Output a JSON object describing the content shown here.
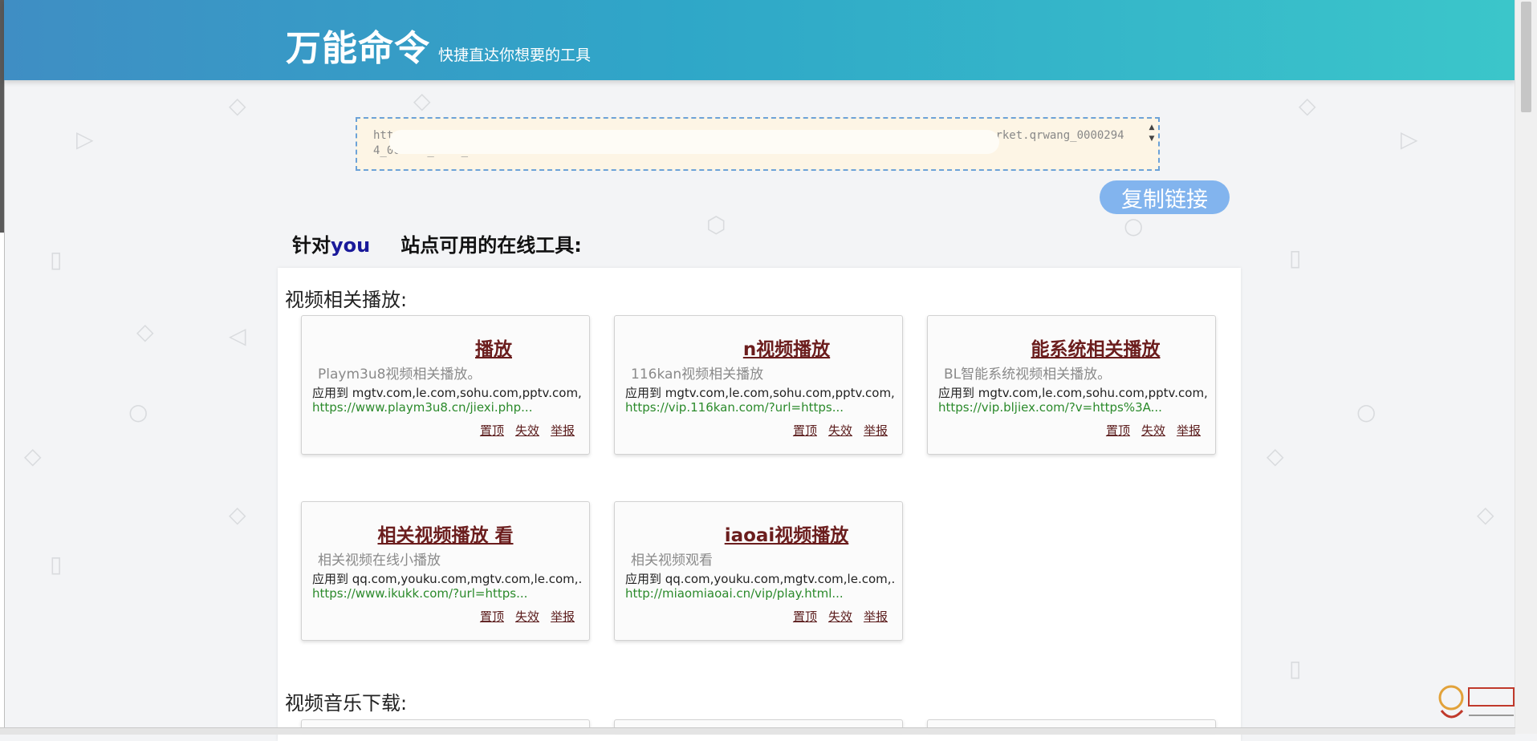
{
  "header": {
    "title": "万能命令",
    "subtitle": "快捷直达你想要的工具"
  },
  "url_box": {
    "text": "https://v.youku.com/v_show/id_XNTM0OTE5...tps=VWhqUNHR6WMwhYBwVmRKW0M&refer=sousuotoufang_market.qrwang_00002944_000000_...i_1903 1900"
  },
  "copy_button": {
    "label": "复制链接"
  },
  "site_heading": {
    "prefix": "针对",
    "site": "you",
    "suffix": "站点可用的在线工具:"
  },
  "actions": {
    "pin": "置顶",
    "invalid": "失效",
    "report": "举报"
  },
  "sections": [
    {
      "title": "视频相关播放:",
      "cards": [
        {
          "title": "播放",
          "desc": "Playm3u8视频相关播放。",
          "sites": "应用到 mgtv.com,le.com,sohu.com,pptv.com,...",
          "url": "https://www.playm3u8.cn/jiexi.php..."
        },
        {
          "title": "n视频播放",
          "desc": "116kan视频相关播放",
          "sites": "应用到 mgtv.com,le.com,sohu.com,pptv.com,...",
          "url": "https://vip.116kan.com/?url=https..."
        },
        {
          "title": "能系统相关播放",
          "desc": "BL智能系统视频相关播放。",
          "sites": "应用到 mgtv.com,le.com,sohu.com,pptv.com,...",
          "url": "https://vip.bljiex.com/?v=https%3A..."
        },
        {
          "title": "相关视频播放 看",
          "desc": "相关视频在线小播放",
          "sites": "应用到 qq.com,youku.com,mgtv.com,le.com,...",
          "url": "https://www.ikukk.com/?url=https..."
        },
        {
          "title": "iaoai视频播放",
          "desc": "相关视频观看",
          "sites": "应用到 qq.com,youku.com,mgtv.com,le.com,...",
          "url": "http://miaomiaoai.cn/vip/play.html..."
        }
      ]
    },
    {
      "title": "视频音乐下载:"
    }
  ],
  "colors": {
    "header_start": "#3f8ec4",
    "header_end": "#3bc6ca",
    "copy_button": "#82b4ee",
    "card_title": "#6b1d1d",
    "card_url": "#2b8a2b",
    "site_name": "#1a1a9a"
  }
}
